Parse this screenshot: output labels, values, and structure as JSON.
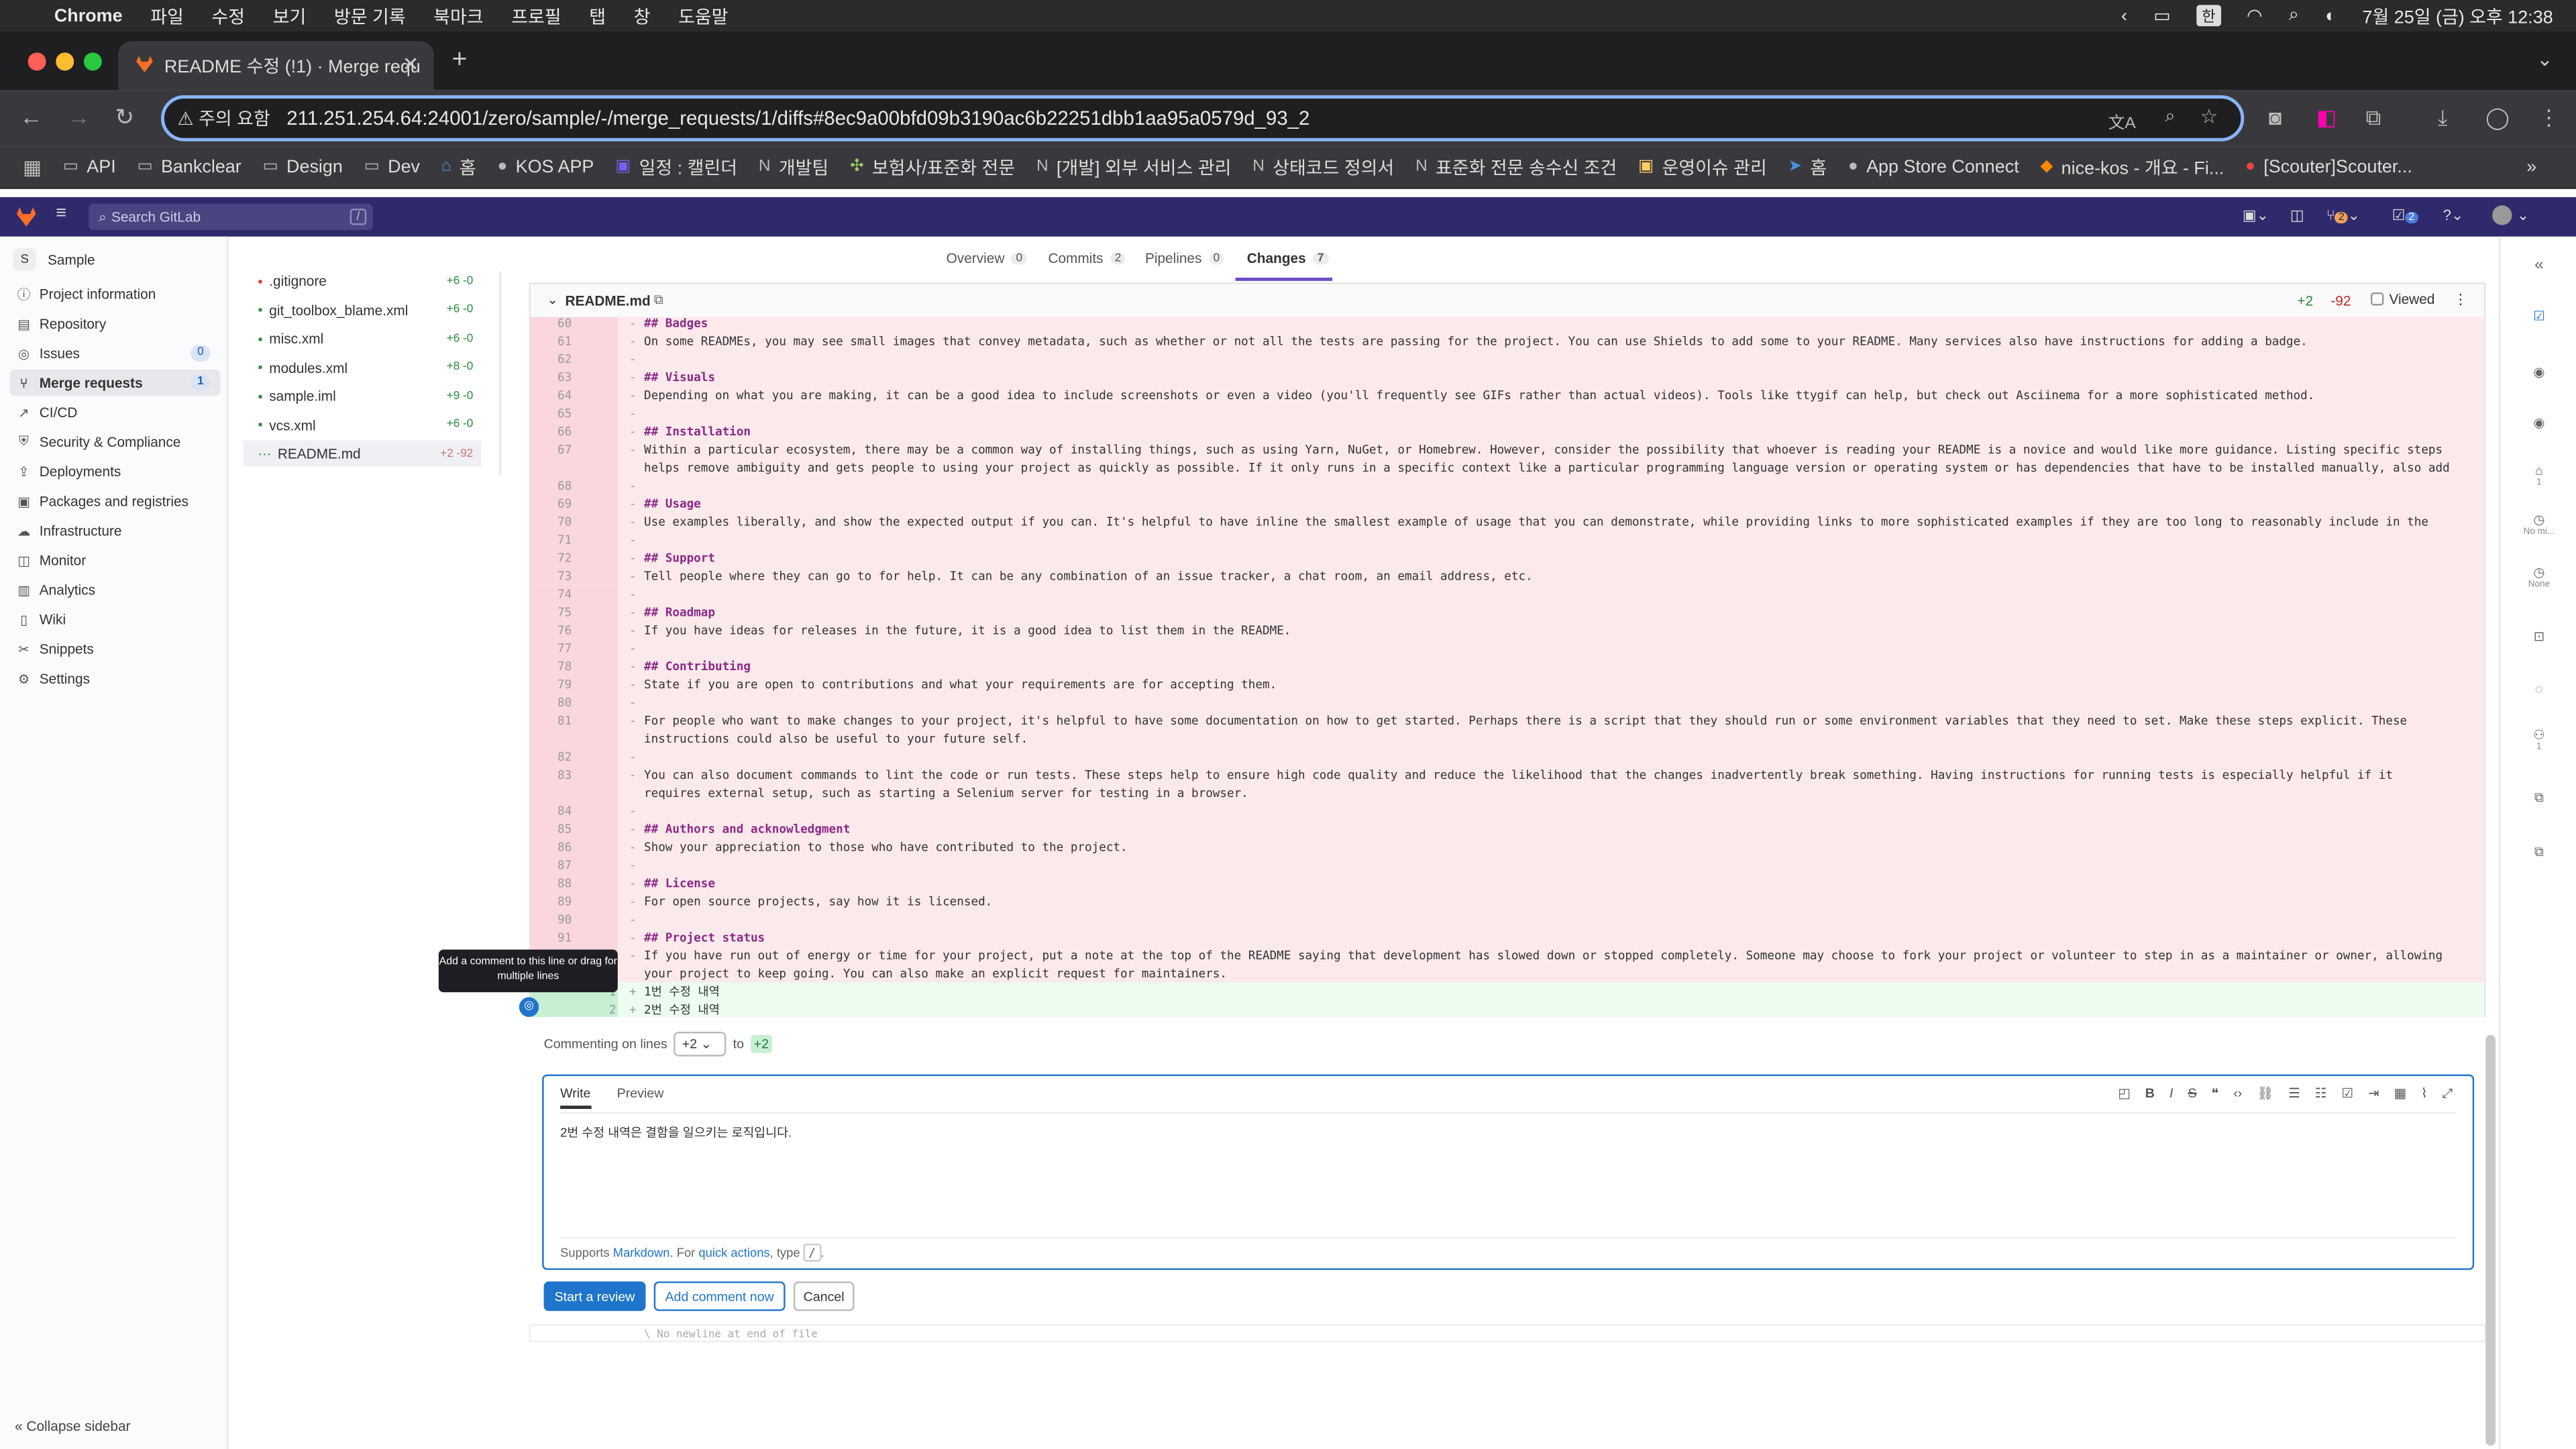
{
  "menubar": {
    "app": "Chrome",
    "items": [
      "파일",
      "수정",
      "보기",
      "방문 기록",
      "북마크",
      "프로필",
      "탭",
      "창",
      "도움말"
    ],
    "datetime": "7월 25일 (금) 오후 12:38"
  },
  "browser": {
    "tab_title": "README 수정 (!1) · Merge requ",
    "security_label": "주의 요함",
    "url": "211.251.254.64:24001/zero/sample/-/merge_requests/1/diffs#8ec9a00bfd09b3190ac6b22251dbb1aa95a0579d_93_2"
  },
  "bookmarks": [
    "API",
    "Bankclear",
    "Design",
    "Dev",
    "홈",
    "KOS APP",
    "일정 : 캘린더",
    "개발팀",
    "보험사/표준화 전문",
    "[개발] 외부 서비스 관리",
    "상태코드 정의서",
    "표준화 전문 송수신 조건",
    "운영이슈 관리",
    "홈",
    "App Store Connect",
    "nice-kos - 개요 - Fi...",
    "[Scouter]Scouter..."
  ],
  "gitlab": {
    "search_placeholder": "Search GitLab",
    "search_shortcut": "/",
    "mr_count": "2",
    "todo_count": "2"
  },
  "sidebar": {
    "project_initial": "S",
    "project_name": "Sample",
    "items": [
      {
        "label": "Project information",
        "icon": "info-icon"
      },
      {
        "label": "Repository",
        "icon": "doc-icon"
      },
      {
        "label": "Issues",
        "icon": "issues-icon",
        "badge": "0"
      },
      {
        "label": "Merge requests",
        "icon": "merge-icon",
        "badge": "1"
      },
      {
        "label": "CI/CD",
        "icon": "rocket-icon"
      },
      {
        "label": "Security & Compliance",
        "icon": "shield-icon"
      },
      {
        "label": "Deployments",
        "icon": "deploy-icon"
      },
      {
        "label": "Packages and registries",
        "icon": "package-icon"
      },
      {
        "label": "Infrastructure",
        "icon": "cloud-icon"
      },
      {
        "label": "Monitor",
        "icon": "monitor-icon"
      },
      {
        "label": "Analytics",
        "icon": "chart-icon"
      },
      {
        "label": "Wiki",
        "icon": "book-icon"
      },
      {
        "label": "Snippets",
        "icon": "scissors-icon"
      },
      {
        "label": "Settings",
        "icon": "gear-icon"
      }
    ],
    "collapse_label": "Collapse sidebar"
  },
  "files": [
    {
      "name": ".gitignore",
      "stat": "+6 -0"
    },
    {
      "name": "git_toolbox_blame.xml",
      "stat": "+6 -0"
    },
    {
      "name": "misc.xml",
      "stat": "+6 -0"
    },
    {
      "name": "modules.xml",
      "stat": "+8 -0"
    },
    {
      "name": "sample.iml",
      "stat": "+9 -0"
    },
    {
      "name": "vcs.xml",
      "stat": "+6 -0"
    },
    {
      "name": "README.md",
      "stat": "+2 -92"
    }
  ],
  "mr_tabs": [
    {
      "label": "Overview",
      "count": "0"
    },
    {
      "label": "Commits",
      "count": "2"
    },
    {
      "label": "Pipelines",
      "count": "0"
    },
    {
      "label": "Changes",
      "count": "7"
    }
  ],
  "diff": {
    "filename": "README.md",
    "added": "+2",
    "removed": "-92",
    "viewed_label": "Viewed",
    "lines": [
      {
        "ln": "60",
        "s": "-",
        "t": "## Badges",
        "h": true
      },
      {
        "ln": "61",
        "s": "-",
        "t": "On some READMEs, you may see small images that convey metadata, such as whether or not all the tests are passing for the project. You can use Shields to add some to your README. Many services also have instructions for adding a badge."
      },
      {
        "ln": "62",
        "s": "-",
        "t": ""
      },
      {
        "ln": "63",
        "s": "-",
        "t": "## Visuals",
        "h": true
      },
      {
        "ln": "64",
        "s": "-",
        "t": "Depending on what you are making, it can be a good idea to include screenshots or even a video (you'll frequently see GIFs rather than actual videos). Tools like ttygif can help, but check out Asciinema for a more sophisticated method."
      },
      {
        "ln": "65",
        "s": "-",
        "t": ""
      },
      {
        "ln": "66",
        "s": "-",
        "t": "## Installation",
        "h": true
      },
      {
        "ln": "67",
        "s": "-",
        "t": "Within a particular ecosystem, there may be a common way of installing things, such as using Yarn, NuGet, or Homebrew. However, consider the possibility that whoever is reading your README is a novice and would like more guidance. Listing specific steps helps remove ambiguity and gets people to using your project as quickly as possible. If it only runs in a specific context like a particular programming language version or operating system or has dependencies that have to be installed manually, also add a Requirements subsection.",
        "two": true
      },
      {
        "ln": "68",
        "s": "-",
        "t": ""
      },
      {
        "ln": "69",
        "s": "-",
        "t": "## Usage",
        "h": true
      },
      {
        "ln": "70",
        "s": "-",
        "t": "Use examples liberally, and show the expected output if you can. It's helpful to have inline the smallest example of usage that you can demonstrate, while providing links to more sophisticated examples if they are too long to reasonably include in the README."
      },
      {
        "ln": "71",
        "s": "-",
        "t": ""
      },
      {
        "ln": "72",
        "s": "-",
        "t": "## Support",
        "h": true
      },
      {
        "ln": "73",
        "s": "-",
        "t": "Tell people where they can go to for help. It can be any combination of an issue tracker, a chat room, an email address, etc."
      },
      {
        "ln": "74",
        "s": "-",
        "t": ""
      },
      {
        "ln": "75",
        "s": "-",
        "t": "## Roadmap",
        "h": true
      },
      {
        "ln": "76",
        "s": "-",
        "t": "If you have ideas for releases in the future, it is a good idea to list them in the README."
      },
      {
        "ln": "77",
        "s": "-",
        "t": ""
      },
      {
        "ln": "78",
        "s": "-",
        "t": "## Contributing",
        "h": true
      },
      {
        "ln": "79",
        "s": "-",
        "t": "State if you are open to contributions and what your requirements are for accepting them."
      },
      {
        "ln": "80",
        "s": "-",
        "t": ""
      },
      {
        "ln": "81",
        "s": "-",
        "t": "For people who want to make changes to your project, it's helpful to have some documentation on how to get started. Perhaps there is a script that they should run or some environment variables that they need to set. Make these steps explicit. These instructions could also be useful to your future self.",
        "two": true
      },
      {
        "ln": "82",
        "s": "-",
        "t": ""
      },
      {
        "ln": "83",
        "s": "-",
        "t": "You can also document commands to lint the code or run tests. These steps help to ensure high code quality and reduce the likelihood that the changes inadvertently break something. Having instructions for running tests is especially helpful if it requires external setup, such as starting a Selenium server for testing in a browser.",
        "two": true
      },
      {
        "ln": "84",
        "s": "-",
        "t": ""
      },
      {
        "ln": "85",
        "s": "-",
        "t": "## Authors and acknowledgment",
        "h": true
      },
      {
        "ln": "86",
        "s": "-",
        "t": "Show your appreciation to those who have contributed to the project."
      },
      {
        "ln": "87",
        "s": "-",
        "t": ""
      },
      {
        "ln": "88",
        "s": "-",
        "t": "## License",
        "h": true
      },
      {
        "ln": "89",
        "s": "-",
        "t": "For open source projects, say how it is licensed."
      },
      {
        "ln": "90",
        "s": "-",
        "t": ""
      },
      {
        "ln": "91",
        "s": "-",
        "t": "## Project status",
        "h": true
      },
      {
        "ln": "92",
        "s": "-",
        "t": "If you have run out of energy or time for your project, put a note at the top of the README saying that development has slowed down or stopped completely. Someone may choose to fork your project or volunteer to step in as a maintainer or owner, allowing your project to keep going. You can also make an explicit request for maintainers.",
        "two": true
      },
      {
        "ln2": "1",
        "s": "+",
        "t": "1번 수정 내역",
        "add": true
      },
      {
        "ln2": "2",
        "s": "+",
        "t": "2번 수정 내역",
        "add": true
      }
    ],
    "no_newline": "\\ No newline at end of file"
  },
  "comment": {
    "lines_label": "Commenting on lines",
    "from": "+2",
    "to_label": "to",
    "to": "+2",
    "tab_write": "Write",
    "tab_preview": "Preview",
    "text": "2번 수정 내역은 결함을 일으키는 로직입니다.",
    "supports": "Supports",
    "markdown": "Markdown",
    "for_label": ". For",
    "quick_actions": "quick actions",
    "type_label": ", type",
    "slash": "/",
    "tooltip": "Add a comment to this line or drag for multiple lines",
    "start_review": "Start a review",
    "add_now": "Add comment now",
    "cancel": "Cancel"
  },
  "rail": {
    "no_milestone": "No mi...",
    "none": "None",
    "count1": "1",
    "count2": "1"
  },
  "colors": {
    "gitlab_header": "#2f2a6b",
    "removed_line": "#fbe9eb",
    "added_line": "#ecfdf0",
    "primary": "#1f75cb"
  }
}
